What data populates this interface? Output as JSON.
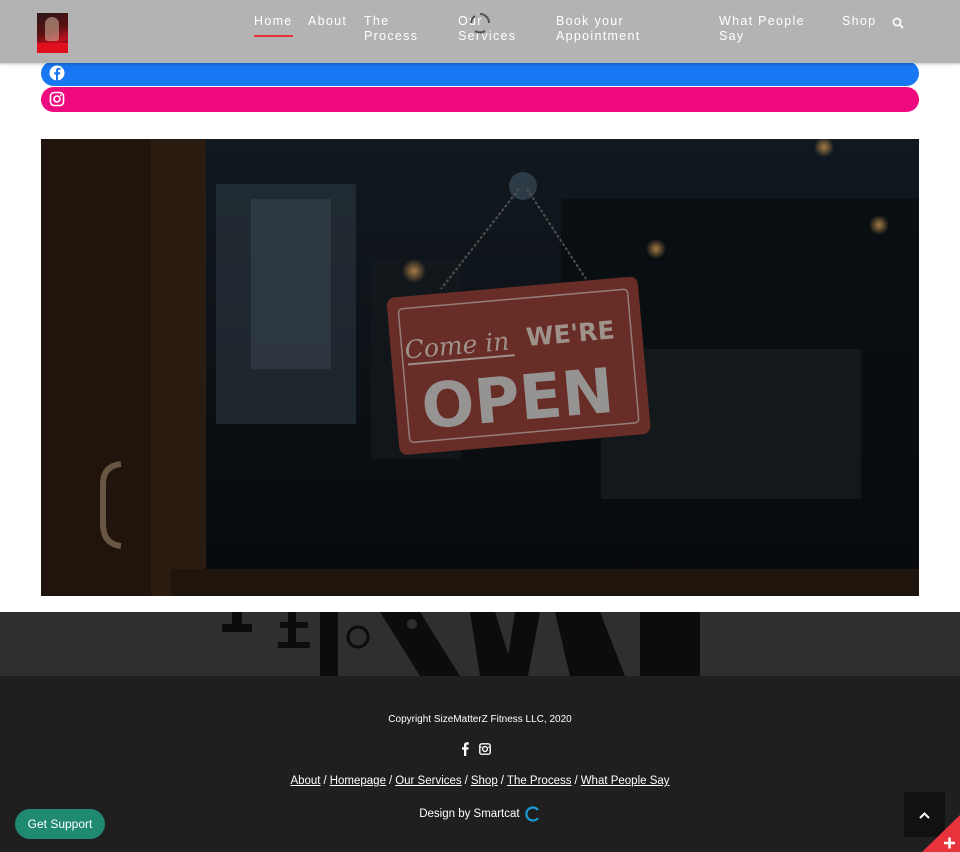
{
  "header": {
    "logo_alt": "",
    "nav": [
      {
        "label": "Home",
        "active": true
      },
      {
        "label": "About"
      },
      {
        "label": "The Process"
      },
      {
        "label": "Our Services"
      },
      {
        "label": "Book your Appointment"
      },
      {
        "label": "What People Say"
      },
      {
        "label": "Shop"
      }
    ],
    "search_icon": "search-icon"
  },
  "social_bars": [
    {
      "network": "facebook",
      "icon": "facebook-icon",
      "color": "#1877f2"
    },
    {
      "network": "instagram",
      "icon": "instagram-icon",
      "color": "#f00a80"
    }
  ],
  "hero_sign": {
    "script_text": "Come in",
    "bold_text": "WE'RE",
    "big_text": "OPEN"
  },
  "footer": {
    "copyright": "Copyright SizeMatterZ Fitness LLC, 2020",
    "links": [
      "About",
      "Homepage",
      "Our Services",
      "Shop",
      "The Process",
      "What People Say"
    ],
    "separator": "/",
    "design_credit": "Design by Smartcat"
  },
  "support": {
    "label": "Get Support"
  },
  "colors": {
    "header_bg": "#b3b3b3",
    "accent": "#e8333c",
    "footer_bg": "#1f1f1f",
    "support_bg": "#1f8a70"
  }
}
